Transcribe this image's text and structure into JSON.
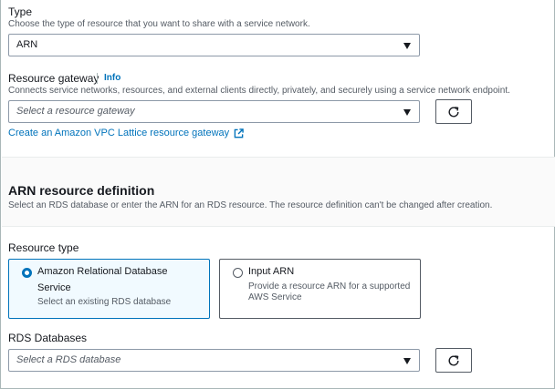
{
  "type_field": {
    "label": "Type",
    "description": "Choose the type of resource that you want to share with a service network.",
    "selected_value": "ARN"
  },
  "resource_gateway_field": {
    "label": "Resource gateway",
    "info_label": "Info",
    "description": "Connects service networks, resources, and external clients directly, privately, and securely using a service network endpoint.",
    "placeholder": "Select a resource gateway",
    "create_link": "Create an Amazon VPC Lattice resource gateway"
  },
  "arn_section": {
    "title": "ARN resource definition",
    "description": "Select an RDS database or enter the ARN for an RDS resource. The resource definition can't be changed after creation."
  },
  "resource_type_field": {
    "label": "Resource type",
    "options": [
      {
        "title": "Amazon Relational Database Service",
        "title_line1": "Amazon Relational Database",
        "title_line2": "Service",
        "description": "Select an existing RDS database",
        "selected": true
      },
      {
        "title": "Input ARN",
        "description_line1": "Provide a resource ARN for a supported",
        "description_line2": "AWS Service",
        "selected": false
      }
    ]
  },
  "rds_databases_field": {
    "label": "RDS Databases",
    "placeholder": "Select a RDS database"
  },
  "colors": {
    "link": "#0073bb",
    "text": "#16191f",
    "secondary_text": "#545b64",
    "border": "#8d99a8"
  },
  "icons": {
    "dropdown": "caret-down-icon",
    "refresh": "refresh-icon",
    "external": "external-link-icon"
  }
}
